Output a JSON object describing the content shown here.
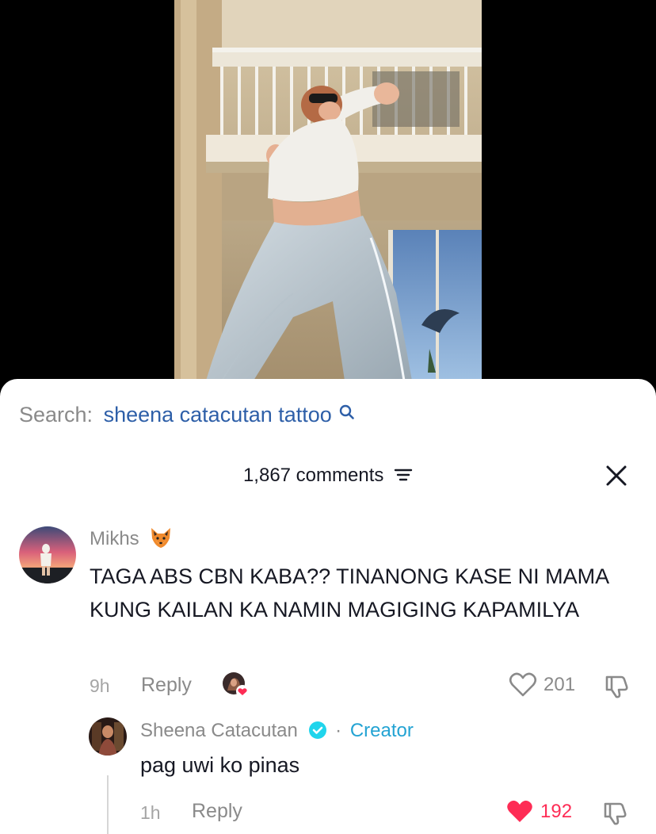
{
  "search": {
    "label": "Search:",
    "term": "sheena catacutan tattoo"
  },
  "comments_header": {
    "count_label": "1,867 comments"
  },
  "comments": [
    {
      "username": "Mikhs",
      "username_emoji": "fox-emoji",
      "text": "TAGA ABS CBN KABA?? TINANONG KASE NI MAMA KUNG KAILAN KA NAMIN MAGIGING KAPAMILYA",
      "time": "9h",
      "reply_label": "Reply",
      "likes": "201",
      "liked": false
    },
    {
      "username": "Sheena Catacutan",
      "verified": true,
      "badge_separator": "·",
      "badge": "Creator",
      "text": "pag uwi ko pinas",
      "time": "1h",
      "reply_label": "Reply",
      "likes": "192",
      "liked": true
    }
  ],
  "colors": {
    "search_term": "#2e5fa8",
    "creator_badge": "#23a3d3",
    "like_active": "#fe2c55",
    "muted_text": "#8a8a8a"
  }
}
